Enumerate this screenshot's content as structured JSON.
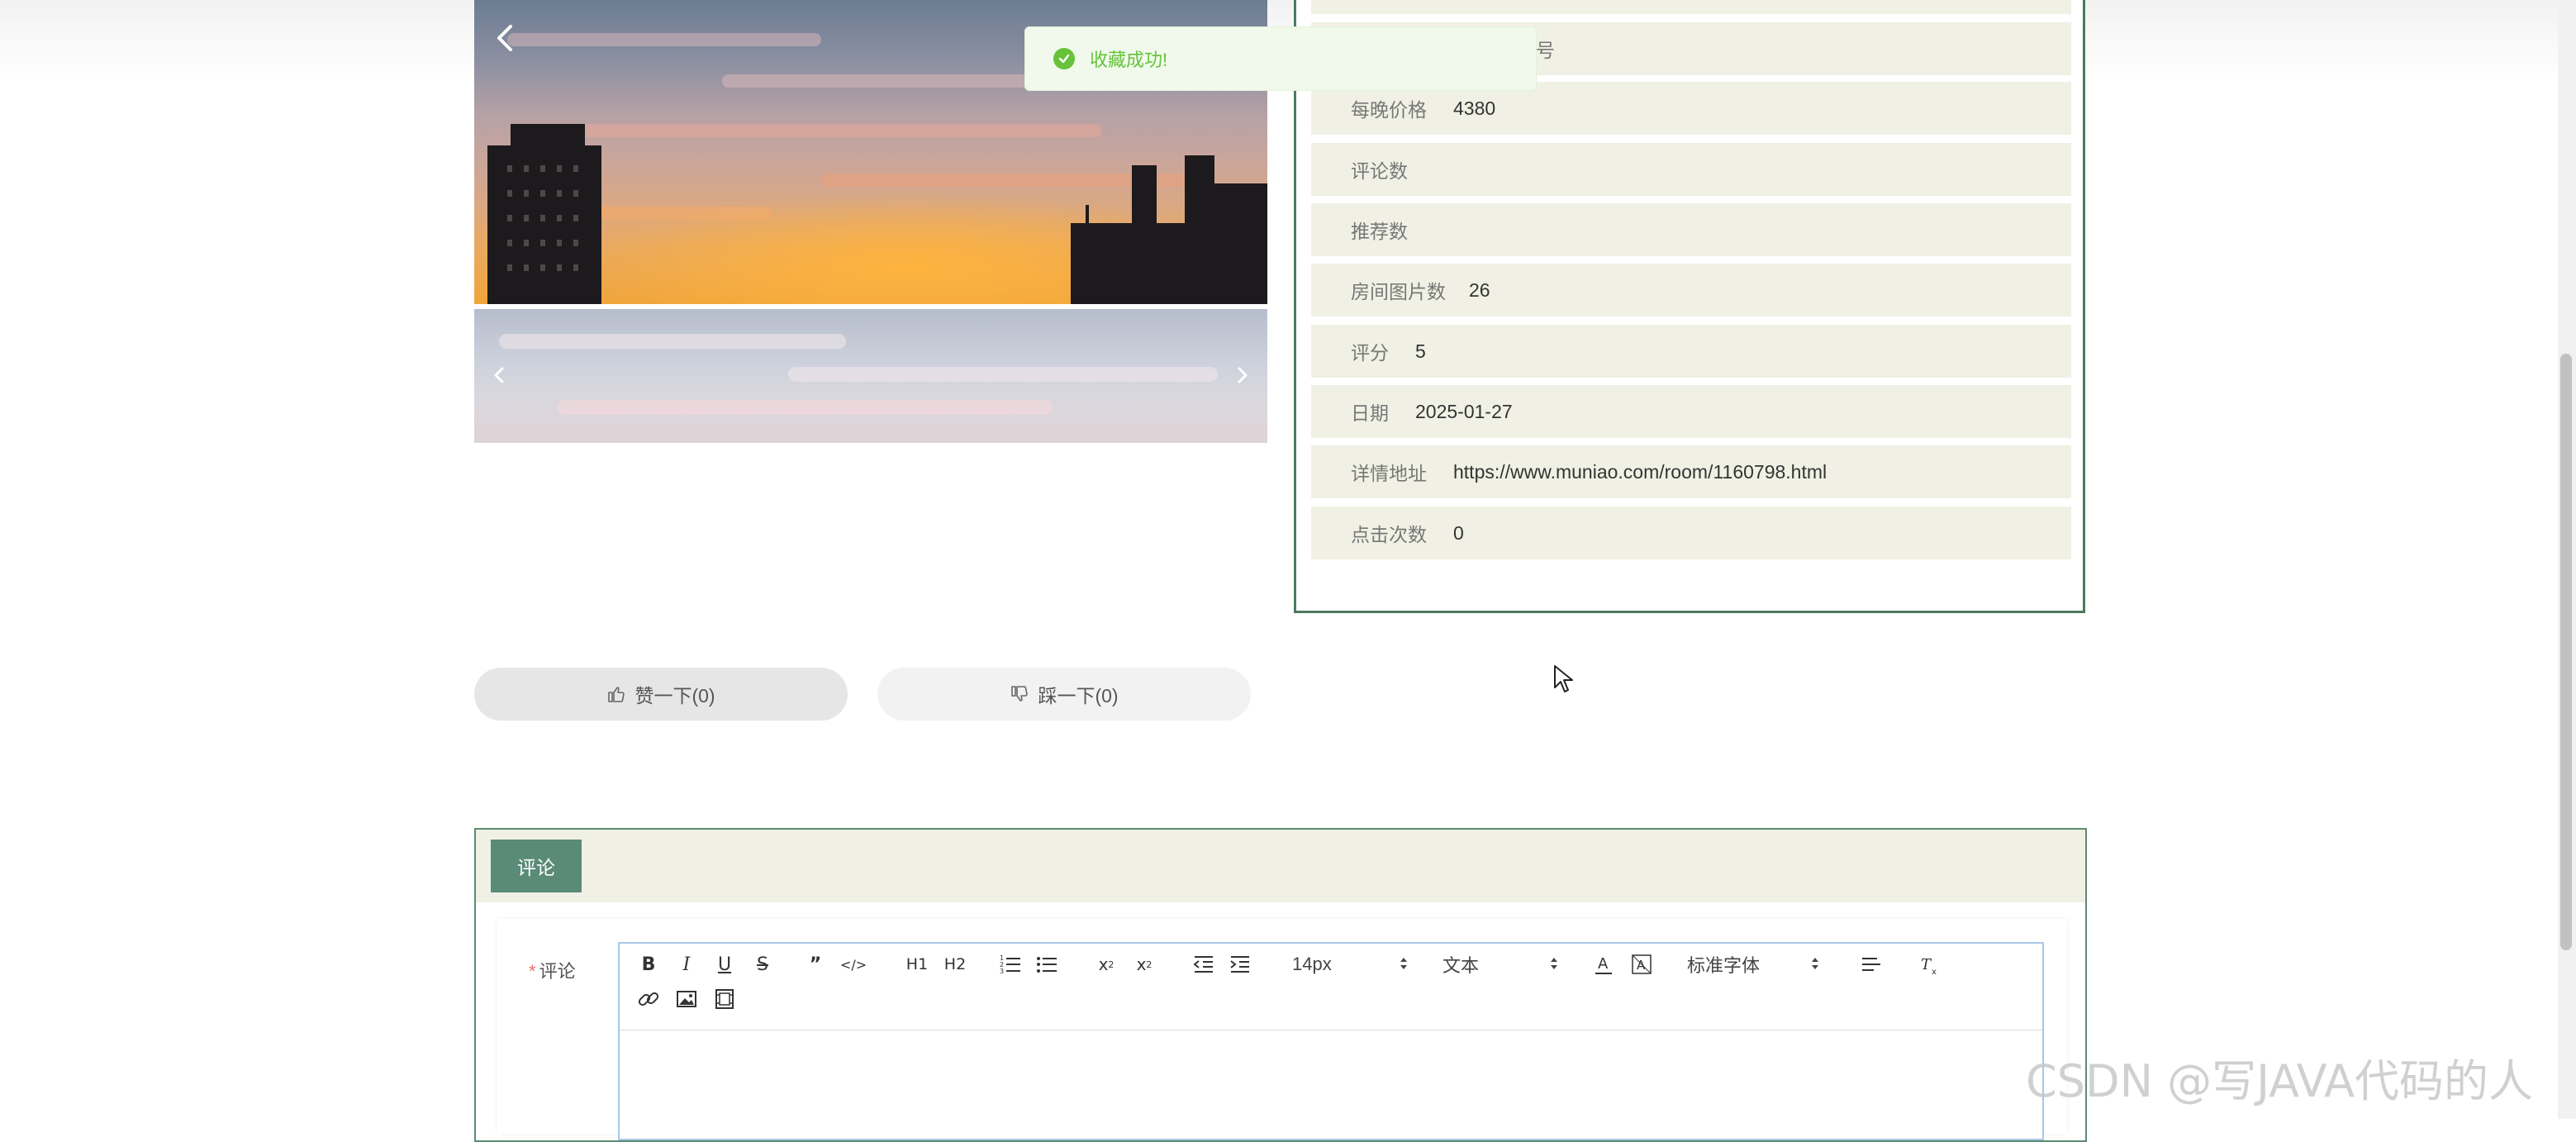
{
  "toast": {
    "message": "收藏成功!"
  },
  "info": {
    "rows": [
      {
        "label": "每晚价格",
        "value": "4380"
      },
      {
        "label": "评论数",
        "value": ""
      },
      {
        "label": "推荐数",
        "value": ""
      },
      {
        "label": "房间图片数",
        "value": "26"
      },
      {
        "label": "评分",
        "value": "5"
      },
      {
        "label": "日期",
        "value": "2025-01-27"
      },
      {
        "label": "详情地址",
        "value": "https://www.muniao.com/room/1160798.html"
      },
      {
        "label": "点击次数",
        "value": "0"
      }
    ],
    "partial_top_char": "号"
  },
  "votes": {
    "up_label": "赞一下(0)",
    "down_label": "踩一下(0)"
  },
  "comment": {
    "tab_label": "评论",
    "field_label": "评论",
    "required_mark": "*",
    "editor": {
      "font_size": "14px",
      "header_select": "文本",
      "font_family": "标准字体",
      "buttons": {
        "h1": "H1",
        "h2": "H2"
      }
    }
  },
  "watermark": "CSDN @写JAVA代码的人",
  "colors": {
    "panel_border": "#4a7a5e",
    "tab_bg": "#5a8a78",
    "row_bg": "#f0f1e4",
    "toast_green": "#67c23a"
  }
}
